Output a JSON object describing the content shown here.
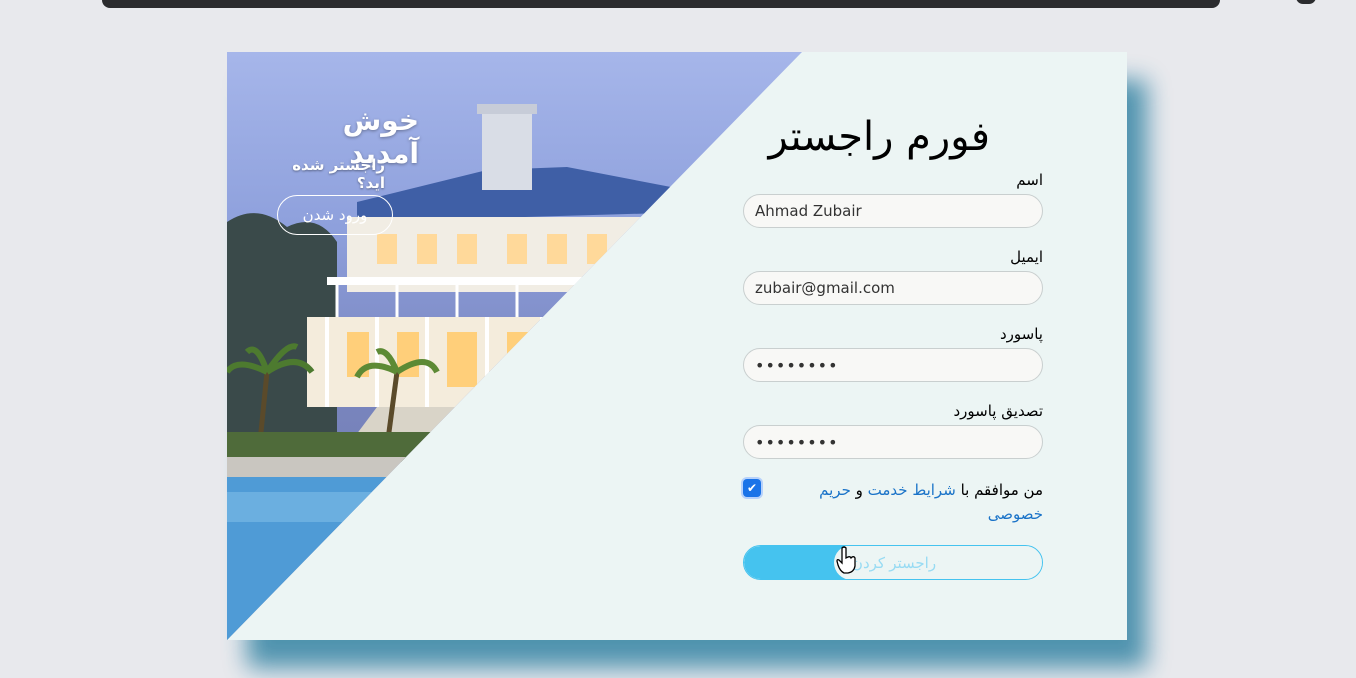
{
  "welcome": {
    "title": "خوش آمدید",
    "subtitle": "راجستر شده اید؟",
    "login_button": "ورود شدن"
  },
  "form": {
    "title": "فورم راجستر",
    "name_label": "اسم",
    "name_value": "Ahmad Zubair",
    "email_label": "ایمیل",
    "email_value": "zubair@gmail.com",
    "password_label": "پاسورد",
    "password_value": "••••••••",
    "confirm_label": "تصدیق پاسورد",
    "confirm_value": "••••••••",
    "agree_prefix": "من موافقم با",
    "terms_link": "شرایط خدمت",
    "agree_and": "و",
    "privacy_link": "حریم خصوصی",
    "agree_checked": true,
    "submit_label": "راجستر کردن",
    "submit_progress": 0.3
  },
  "colors": {
    "accent": "#45c3ef",
    "link": "#1a73c8",
    "card_bg": "#ecf5f4",
    "shadow": "#3f8aa8"
  },
  "icons": [
    "check-icon",
    "hand-pointer-icon"
  ]
}
